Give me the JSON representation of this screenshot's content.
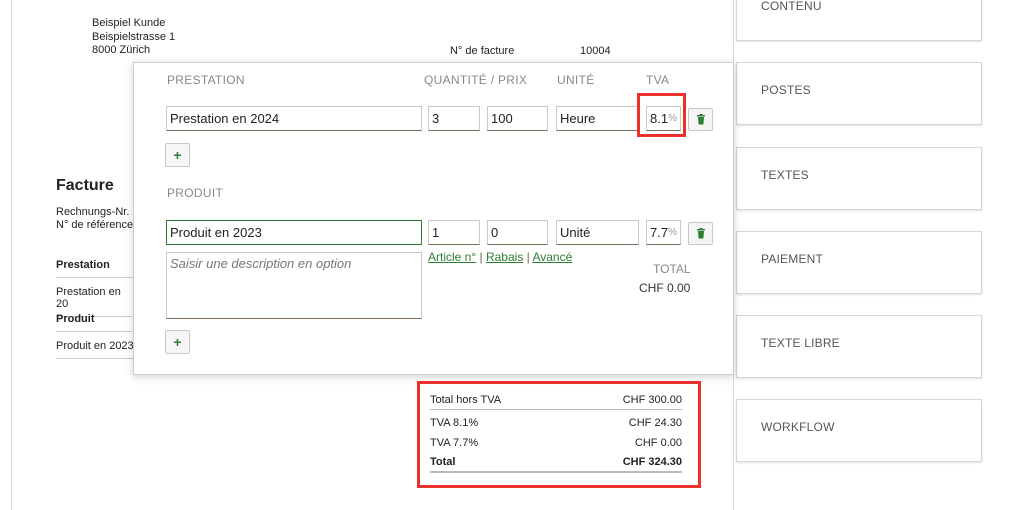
{
  "invoice": {
    "address": [
      "Beispiel Kunde",
      "Beispielstrasse 1",
      "8000 Zürich"
    ],
    "invoice_number_label": "N° de facture",
    "invoice_number": "10004",
    "title": "Facture",
    "meta": [
      "Rechnungs-Nr.",
      "N° de référence"
    ],
    "section_prestation": "Prestation",
    "row_prestation": "Prestation en 20",
    "section_produit": "Produit",
    "row_produit": "Produit en 2023"
  },
  "totals": {
    "net_label": "Total hors TVA",
    "net_value": "CHF 300.00",
    "vat1_label": "TVA 8.1%",
    "vat1_value": "CHF 24.30",
    "vat2_label": "TVA 7.7%",
    "vat2_value": "CHF 0.00",
    "total_label": "Total",
    "total_value": "CHF 324.30"
  },
  "side_panel": {
    "items": [
      "CONTENU",
      "POSTES",
      "TEXTES",
      "PAIEMENT",
      "TEXTE LIBRE",
      "WORKFLOW"
    ]
  },
  "editor": {
    "headers": {
      "prestation": "PRESTATION",
      "qty_price": "QUANTITÉ / PRIX",
      "unit": "UNITÉ",
      "vat": "TVA",
      "produit": "PRODUIT"
    },
    "row1": {
      "name": "Prestation en 2024",
      "qty": "3",
      "price": "100",
      "unit": "Heure",
      "vat": "8.1",
      "pct": "%"
    },
    "row2": {
      "name": "Produit en 2023",
      "qty": "1",
      "price": "0",
      "unit": "Unité",
      "vat": "7.7",
      "pct": "%"
    },
    "description_placeholder": "Saisir une description en option",
    "link_article": "Article n°",
    "link_rabais": "Rabais",
    "link_avance": "Avancé",
    "separator": "|",
    "total_label": "TOTAL",
    "total_value": "CHF 0.00",
    "add_symbol": "+"
  },
  "colors": {
    "highlight": "#e8312a",
    "accent": "#2e7d32"
  }
}
